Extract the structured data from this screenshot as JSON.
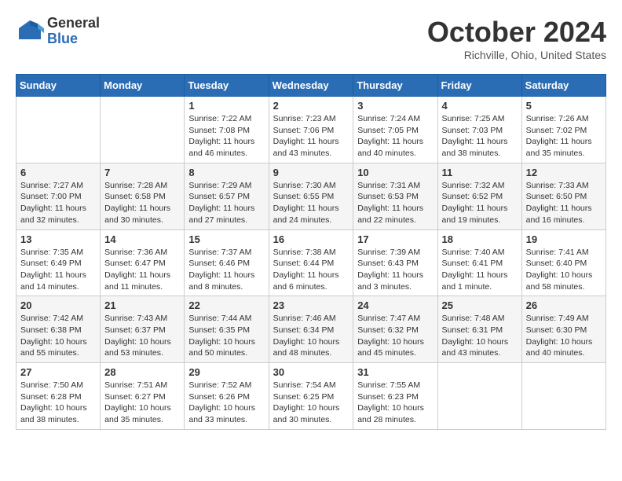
{
  "logo": {
    "general": "General",
    "blue": "Blue"
  },
  "title": "October 2024",
  "location": "Richville, Ohio, United States",
  "days_of_week": [
    "Sunday",
    "Monday",
    "Tuesday",
    "Wednesday",
    "Thursday",
    "Friday",
    "Saturday"
  ],
  "weeks": [
    [
      {
        "day": "",
        "sunrise": "",
        "sunset": "",
        "daylight": ""
      },
      {
        "day": "",
        "sunrise": "",
        "sunset": "",
        "daylight": ""
      },
      {
        "day": "1",
        "sunrise": "Sunrise: 7:22 AM",
        "sunset": "Sunset: 7:08 PM",
        "daylight": "Daylight: 11 hours and 46 minutes."
      },
      {
        "day": "2",
        "sunrise": "Sunrise: 7:23 AM",
        "sunset": "Sunset: 7:06 PM",
        "daylight": "Daylight: 11 hours and 43 minutes."
      },
      {
        "day": "3",
        "sunrise": "Sunrise: 7:24 AM",
        "sunset": "Sunset: 7:05 PM",
        "daylight": "Daylight: 11 hours and 40 minutes."
      },
      {
        "day": "4",
        "sunrise": "Sunrise: 7:25 AM",
        "sunset": "Sunset: 7:03 PM",
        "daylight": "Daylight: 11 hours and 38 minutes."
      },
      {
        "day": "5",
        "sunrise": "Sunrise: 7:26 AM",
        "sunset": "Sunset: 7:02 PM",
        "daylight": "Daylight: 11 hours and 35 minutes."
      }
    ],
    [
      {
        "day": "6",
        "sunrise": "Sunrise: 7:27 AM",
        "sunset": "Sunset: 7:00 PM",
        "daylight": "Daylight: 11 hours and 32 minutes."
      },
      {
        "day": "7",
        "sunrise": "Sunrise: 7:28 AM",
        "sunset": "Sunset: 6:58 PM",
        "daylight": "Daylight: 11 hours and 30 minutes."
      },
      {
        "day": "8",
        "sunrise": "Sunrise: 7:29 AM",
        "sunset": "Sunset: 6:57 PM",
        "daylight": "Daylight: 11 hours and 27 minutes."
      },
      {
        "day": "9",
        "sunrise": "Sunrise: 7:30 AM",
        "sunset": "Sunset: 6:55 PM",
        "daylight": "Daylight: 11 hours and 24 minutes."
      },
      {
        "day": "10",
        "sunrise": "Sunrise: 7:31 AM",
        "sunset": "Sunset: 6:53 PM",
        "daylight": "Daylight: 11 hours and 22 minutes."
      },
      {
        "day": "11",
        "sunrise": "Sunrise: 7:32 AM",
        "sunset": "Sunset: 6:52 PM",
        "daylight": "Daylight: 11 hours and 19 minutes."
      },
      {
        "day": "12",
        "sunrise": "Sunrise: 7:33 AM",
        "sunset": "Sunset: 6:50 PM",
        "daylight": "Daylight: 11 hours and 16 minutes."
      }
    ],
    [
      {
        "day": "13",
        "sunrise": "Sunrise: 7:35 AM",
        "sunset": "Sunset: 6:49 PM",
        "daylight": "Daylight: 11 hours and 14 minutes."
      },
      {
        "day": "14",
        "sunrise": "Sunrise: 7:36 AM",
        "sunset": "Sunset: 6:47 PM",
        "daylight": "Daylight: 11 hours and 11 minutes."
      },
      {
        "day": "15",
        "sunrise": "Sunrise: 7:37 AM",
        "sunset": "Sunset: 6:46 PM",
        "daylight": "Daylight: 11 hours and 8 minutes."
      },
      {
        "day": "16",
        "sunrise": "Sunrise: 7:38 AM",
        "sunset": "Sunset: 6:44 PM",
        "daylight": "Daylight: 11 hours and 6 minutes."
      },
      {
        "day": "17",
        "sunrise": "Sunrise: 7:39 AM",
        "sunset": "Sunset: 6:43 PM",
        "daylight": "Daylight: 11 hours and 3 minutes."
      },
      {
        "day": "18",
        "sunrise": "Sunrise: 7:40 AM",
        "sunset": "Sunset: 6:41 PM",
        "daylight": "Daylight: 11 hours and 1 minute."
      },
      {
        "day": "19",
        "sunrise": "Sunrise: 7:41 AM",
        "sunset": "Sunset: 6:40 PM",
        "daylight": "Daylight: 10 hours and 58 minutes."
      }
    ],
    [
      {
        "day": "20",
        "sunrise": "Sunrise: 7:42 AM",
        "sunset": "Sunset: 6:38 PM",
        "daylight": "Daylight: 10 hours and 55 minutes."
      },
      {
        "day": "21",
        "sunrise": "Sunrise: 7:43 AM",
        "sunset": "Sunset: 6:37 PM",
        "daylight": "Daylight: 10 hours and 53 minutes."
      },
      {
        "day": "22",
        "sunrise": "Sunrise: 7:44 AM",
        "sunset": "Sunset: 6:35 PM",
        "daylight": "Daylight: 10 hours and 50 minutes."
      },
      {
        "day": "23",
        "sunrise": "Sunrise: 7:46 AM",
        "sunset": "Sunset: 6:34 PM",
        "daylight": "Daylight: 10 hours and 48 minutes."
      },
      {
        "day": "24",
        "sunrise": "Sunrise: 7:47 AM",
        "sunset": "Sunset: 6:32 PM",
        "daylight": "Daylight: 10 hours and 45 minutes."
      },
      {
        "day": "25",
        "sunrise": "Sunrise: 7:48 AM",
        "sunset": "Sunset: 6:31 PM",
        "daylight": "Daylight: 10 hours and 43 minutes."
      },
      {
        "day": "26",
        "sunrise": "Sunrise: 7:49 AM",
        "sunset": "Sunset: 6:30 PM",
        "daylight": "Daylight: 10 hours and 40 minutes."
      }
    ],
    [
      {
        "day": "27",
        "sunrise": "Sunrise: 7:50 AM",
        "sunset": "Sunset: 6:28 PM",
        "daylight": "Daylight: 10 hours and 38 minutes."
      },
      {
        "day": "28",
        "sunrise": "Sunrise: 7:51 AM",
        "sunset": "Sunset: 6:27 PM",
        "daylight": "Daylight: 10 hours and 35 minutes."
      },
      {
        "day": "29",
        "sunrise": "Sunrise: 7:52 AM",
        "sunset": "Sunset: 6:26 PM",
        "daylight": "Daylight: 10 hours and 33 minutes."
      },
      {
        "day": "30",
        "sunrise": "Sunrise: 7:54 AM",
        "sunset": "Sunset: 6:25 PM",
        "daylight": "Daylight: 10 hours and 30 minutes."
      },
      {
        "day": "31",
        "sunrise": "Sunrise: 7:55 AM",
        "sunset": "Sunset: 6:23 PM",
        "daylight": "Daylight: 10 hours and 28 minutes."
      },
      {
        "day": "",
        "sunrise": "",
        "sunset": "",
        "daylight": ""
      },
      {
        "day": "",
        "sunrise": "",
        "sunset": "",
        "daylight": ""
      }
    ]
  ]
}
